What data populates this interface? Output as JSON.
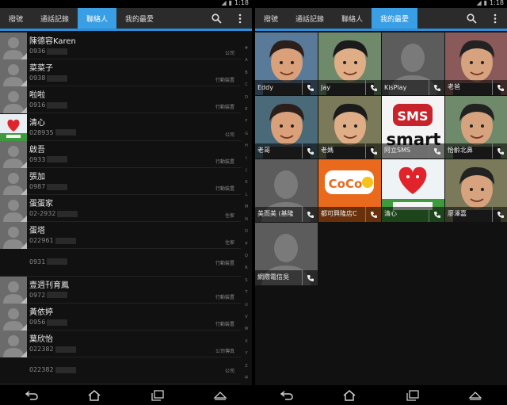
{
  "left": {
    "status": {
      "time": "1:18"
    },
    "tabs": [
      {
        "label": "撥號",
        "active": false
      },
      {
        "label": "通話記錄",
        "active": false
      },
      {
        "label": "聯絡人",
        "active": true
      },
      {
        "label": "我的最愛",
        "active": false
      }
    ],
    "contacts": [
      {
        "name": "陳德容Karen",
        "number": "0936",
        "type": "公司"
      },
      {
        "name": "菜菜子",
        "number": "0938",
        "type": "行動裝置"
      },
      {
        "name": "啦啦",
        "number": "0916",
        "type": "行動裝置"
      },
      {
        "name": "清心",
        "number": "028935",
        "type": "公司"
      },
      {
        "name": "啟吾",
        "number": "0933",
        "type": "行動裝置"
      },
      {
        "name": "張加",
        "number": "0987",
        "type": "行動裝置"
      },
      {
        "name": "蛋蛋家",
        "number": "02-2932",
        "type": "住家"
      },
      {
        "name": "蛋塔",
        "number": "022961",
        "type": "住家"
      },
      {
        "name": "",
        "number": "0931",
        "type": "行動裝置"
      },
      {
        "name": "壹週刊育鳳",
        "number": "0972",
        "type": "行動裝置"
      },
      {
        "name": "黃依婷",
        "number": "0956",
        "type": "行動裝置"
      },
      {
        "name": "葉欣怡",
        "number": "022382",
        "type": "公司傳真"
      },
      {
        "name": "",
        "number": "022382",
        "type": "公司"
      }
    ],
    "index": [
      "#",
      "A",
      "B",
      "C",
      "D",
      "E",
      "F",
      "G",
      "H",
      "I",
      "J",
      "K",
      "L",
      "M",
      "N",
      "O",
      "P",
      "Q",
      "R",
      "S",
      "T",
      "U",
      "V",
      "W",
      "X",
      "Y",
      "Z",
      "中"
    ]
  },
  "right": {
    "status": {
      "time": "1:18"
    },
    "tabs": [
      {
        "label": "撥號",
        "active": false
      },
      {
        "label": "通話記錄",
        "active": false
      },
      {
        "label": "聯絡人",
        "active": false
      },
      {
        "label": "我的最愛",
        "active": true
      }
    ],
    "favorites": [
      {
        "name": "Eddy",
        "photo": "person"
      },
      {
        "name": "Jay",
        "photo": "person"
      },
      {
        "name": "KisPlay",
        "photo": "placeholder"
      },
      {
        "name": "老爸",
        "photo": "person"
      },
      {
        "name": "老哥",
        "photo": "person"
      },
      {
        "name": "老媽",
        "photo": "person"
      },
      {
        "name": "阿立SMS",
        "photo": "sms-logo"
      },
      {
        "name": "怡齡北鼻",
        "photo": "person"
      },
      {
        "name": "美而美 (基隆",
        "photo": "placeholder"
      },
      {
        "name": "都可興隆店C",
        "photo": "coco-logo"
      },
      {
        "name": "清心",
        "photo": "heart-logo"
      },
      {
        "name": "廖澤嘉",
        "photo": "person"
      },
      {
        "name": "網際電信吳",
        "photo": "placeholder"
      }
    ],
    "logos": {
      "sms": "SMS",
      "smart": "smart",
      "coco": "CoCo"
    }
  },
  "colors": {
    "accent": "#3a9ee4",
    "tabbar": "#2b2b2b",
    "underline": "#2b8ed6"
  }
}
